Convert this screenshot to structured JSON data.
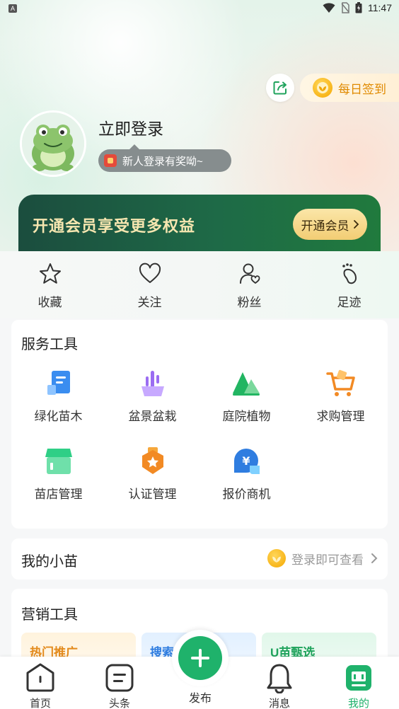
{
  "status_bar": {
    "time": "11:47",
    "app_icon": "A"
  },
  "header": {
    "share_icon": "share-icon",
    "signin_label": "每日签到",
    "login_title": "立即登录",
    "reward_text": "新人登录有奖呦~"
  },
  "vip": {
    "text": "开通会员享受更多权益",
    "button_label": "开通会员"
  },
  "quick": [
    {
      "label": "收藏",
      "icon": "star-icon"
    },
    {
      "label": "关注",
      "icon": "heart-icon"
    },
    {
      "label": "粉丝",
      "icon": "fans-icon"
    },
    {
      "label": "足迹",
      "icon": "footprint-icon"
    }
  ],
  "services": {
    "title": "服务工具",
    "items": [
      {
        "label": "绿化苗木",
        "icon": "greening-icon"
      },
      {
        "label": "盆景盆栽",
        "icon": "bonsai-icon"
      },
      {
        "label": "庭院植物",
        "icon": "garden-icon"
      },
      {
        "label": "求购管理",
        "icon": "cart-icon"
      },
      {
        "label": "苗店管理",
        "icon": "store-icon"
      },
      {
        "label": "认证管理",
        "icon": "certification-icon"
      },
      {
        "label": "报价商机",
        "icon": "quote-icon"
      }
    ]
  },
  "xiaomiao": {
    "title": "我的小苗",
    "hint": "登录即可查看"
  },
  "marketing": {
    "title": "营销工具",
    "tiles": [
      {
        "label": "热门推广",
        "color": "#e38a1c"
      },
      {
        "label": "搜索",
        "color": "#2f7de0"
      },
      {
        "label": "U苗甄选",
        "color": "#1fa35c"
      }
    ]
  },
  "nav": {
    "home": "首页",
    "headlines": "头条",
    "publish": "发布",
    "messages": "消息",
    "mine": "我的",
    "accent": "#1fb26b"
  }
}
